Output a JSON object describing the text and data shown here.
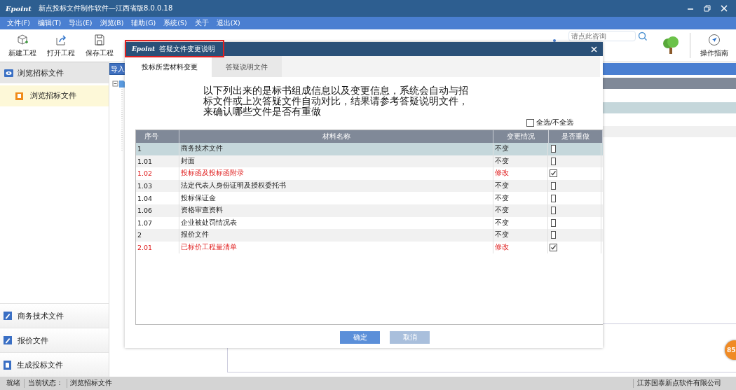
{
  "window": {
    "logo": "Epoint",
    "title": "新点投标文件制作软件—江西省版8.0.0.18"
  },
  "menu": [
    "文件(F)",
    "编辑(T)",
    "导出(E)",
    "浏览(B)",
    "辅助(G)",
    "系统(S)",
    "关于",
    "退出(X)"
  ],
  "toolbar": {
    "buttons": [
      "新建工程",
      "打开工程",
      "保存工程"
    ],
    "search": {
      "placeholder": "请点此咨询"
    },
    "guide": "操作指南"
  },
  "sidebar": {
    "header": {
      "label": "浏览招标文件",
      "selected": true
    },
    "subitems": [
      {
        "label": "浏览招标文件",
        "selected": true
      }
    ],
    "sections": [
      "商务技术文件",
      "报价文件",
      "生成投标文件"
    ]
  },
  "main": {
    "tab": "导入"
  },
  "dialog": {
    "logo": "Epoint",
    "title": "答疑文件变更说明",
    "tabs": [
      {
        "label": "投标所需材料变更",
        "selected": true
      },
      {
        "label": "答疑说明文件",
        "selected": false
      }
    ],
    "description": "以下列出来的是标书组成信息以及变更信息，系统会自动与招标文件或上次答疑文件自动对比，结果请参考答疑说明文件，来确认哪些文件是否有重做",
    "select_all": {
      "label": "全选/不全选",
      "checked": false
    },
    "columns": [
      "序号",
      "材料名称",
      "变更情况",
      "是否重做"
    ],
    "rows": [
      {
        "no": "1",
        "name": "商务技术文件",
        "change": "不变",
        "changed": false,
        "redo": false,
        "selected": true
      },
      {
        "no": "1.01",
        "name": "封面",
        "change": "不变",
        "changed": false,
        "redo": false,
        "selected": false
      },
      {
        "no": "1.02",
        "name": "投标函及投标函附录",
        "change": "修改",
        "changed": true,
        "redo": true,
        "selected": false
      },
      {
        "no": "1.03",
        "name": "法定代表人身份证明及授权委托书",
        "change": "不变",
        "changed": false,
        "redo": false,
        "selected": false
      },
      {
        "no": "1.04",
        "name": "投标保证金",
        "change": "不变",
        "changed": false,
        "redo": false,
        "selected": false
      },
      {
        "no": "1.06",
        "name": "资格审查资料",
        "change": "不变",
        "changed": false,
        "redo": false,
        "selected": false
      },
      {
        "no": "1.07",
        "name": "企业被处罚情况表",
        "change": "不变",
        "changed": false,
        "redo": false,
        "selected": false
      },
      {
        "no": "2",
        "name": "报价文件",
        "change": "不变",
        "changed": false,
        "redo": false,
        "selected": false
      },
      {
        "no": "2.01",
        "name": "已标价工程量清单",
        "change": "修改",
        "changed": true,
        "redo": true,
        "selected": false
      }
    ],
    "buttons": [
      {
        "label": "确定",
        "disabled": false
      },
      {
        "label": "取消",
        "disabled": true
      }
    ]
  },
  "status_bar": {
    "ready": "就绪",
    "state_label": "当前状态：",
    "state_value": "浏览招标文件",
    "company": "江苏国泰新点软件有限公司"
  },
  "badge": "85"
}
